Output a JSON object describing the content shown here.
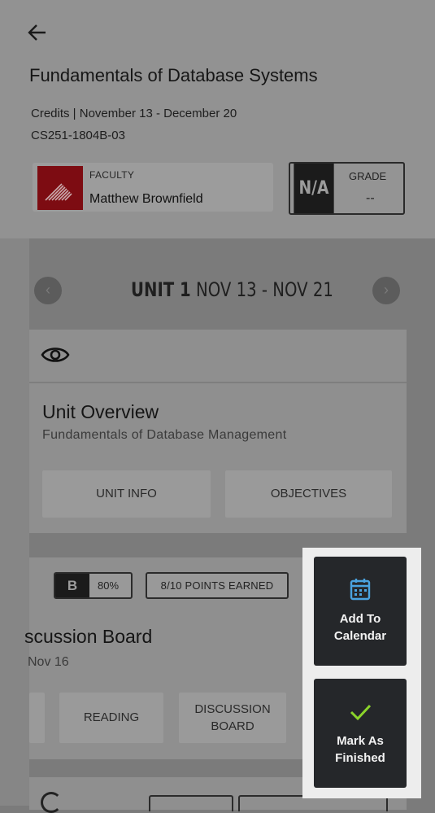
{
  "course": {
    "title": "Fundamentals of Database Systems",
    "meta_line1": "Credits | November 13 - December 20",
    "meta_line2": "CS251-1804B-03"
  },
  "faculty": {
    "label": "FACULTY",
    "name": "Matthew Brownfield"
  },
  "grade": {
    "letter": "N/A",
    "label": "GRADE",
    "value": "--"
  },
  "unit_nav": {
    "unit": "UNIT 1",
    "dates": "NOV 13 - NOV 21"
  },
  "overview": {
    "title": "Unit Overview",
    "subtitle": "Fundamentals of Database Management",
    "buttons": [
      "UNIT INFO",
      "OBJECTIVES"
    ]
  },
  "discussion": {
    "grade_letter": "B",
    "grade_percent": "80%",
    "points": "8/10 POINTS EARNED",
    "title": "scussion Board",
    "date": "Nov 16",
    "buttons": [
      "READING",
      "DISCUSSION BOARD"
    ]
  },
  "actions": {
    "add_to_calendar": "Add To Calendar",
    "mark_as_finished": "Mark As Finished",
    "calendar_icon_color": "#4aa3e0",
    "check_icon_color": "#8bd42a"
  },
  "icons": [
    "back-arrow-icon",
    "eye-icon",
    "chevron-left-icon",
    "chevron-right-icon",
    "calendar-icon",
    "checkmark-icon"
  ]
}
